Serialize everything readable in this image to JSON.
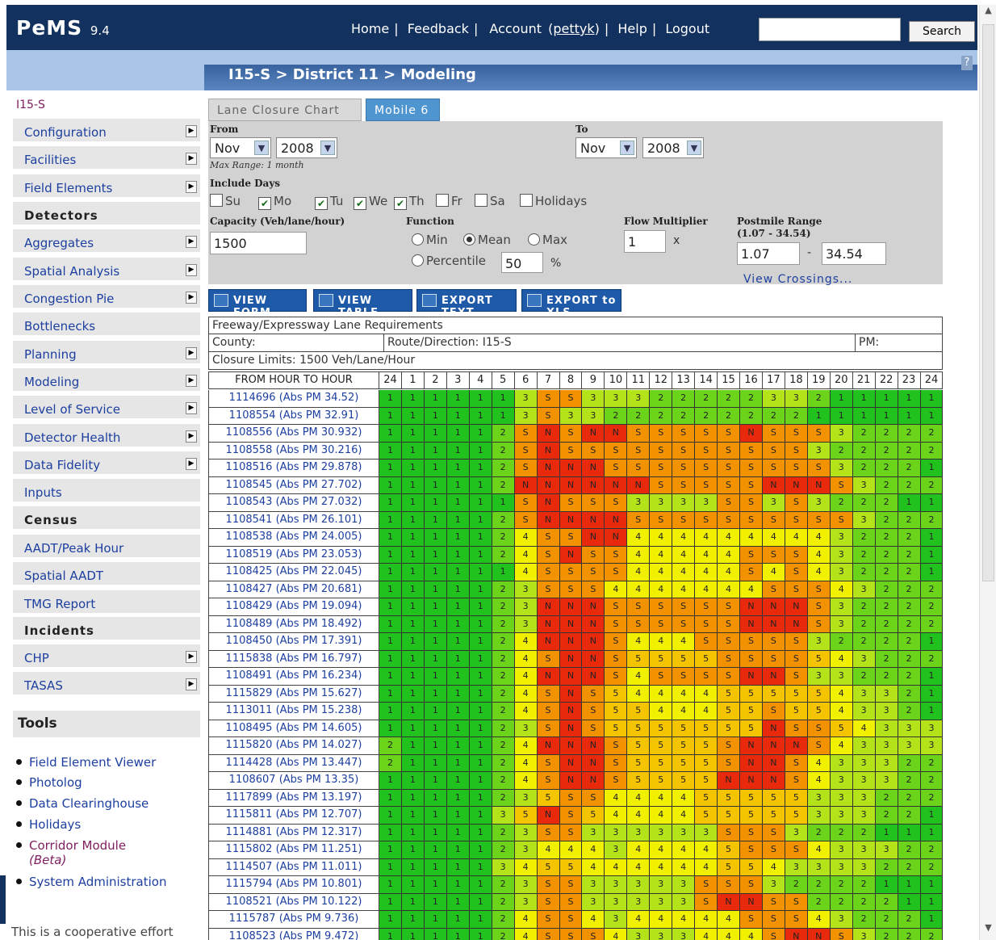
{
  "app": {
    "name": "PeMS",
    "version": "9.4"
  },
  "topnav": {
    "home": "Home",
    "feedback": "Feedback",
    "account": "Account",
    "account_user": "pettyk",
    "help": "Help",
    "logout": "Logout",
    "search_label": "Search",
    "search_value": ""
  },
  "breadcrumb": "I15-S > District 11 > Modeling",
  "help_icon": "?",
  "sidebar": {
    "title": "I15-S",
    "items": [
      {
        "label": "Configuration",
        "arrow": true
      },
      {
        "label": "Facilities",
        "arrow": true
      },
      {
        "label": "Field Elements",
        "arrow": true
      },
      {
        "label": "Detectors",
        "header": true
      },
      {
        "label": "Aggregates",
        "arrow": true
      },
      {
        "label": "Spatial Analysis",
        "arrow": true
      },
      {
        "label": "Congestion Pie",
        "arrow": true
      },
      {
        "label": "Bottlenecks",
        "arrow": false
      },
      {
        "label": "Planning",
        "arrow": true
      },
      {
        "label": "Modeling",
        "arrow": true
      },
      {
        "label": "Level of Service",
        "arrow": true
      },
      {
        "label": "Detector Health",
        "arrow": true
      },
      {
        "label": "Data Fidelity",
        "arrow": true
      },
      {
        "label": "Inputs",
        "arrow": false
      },
      {
        "label": "Census",
        "header": true
      },
      {
        "label": "AADT/Peak Hour",
        "arrow": false
      },
      {
        "label": "Spatial AADT",
        "arrow": false
      },
      {
        "label": "TMG Report",
        "arrow": false
      },
      {
        "label": "Incidents",
        "header": true
      },
      {
        "label": "CHP",
        "arrow": true
      },
      {
        "label": "TASAS",
        "arrow": true
      }
    ],
    "tools_title": "Tools",
    "tools": [
      "Field Element Viewer",
      "Photolog",
      "Data Clearinghouse",
      "Holidays",
      "Corridor Module",
      "System Administration"
    ],
    "tools_beta": "(Beta)",
    "coop_text": "This is a cooperative effort"
  },
  "tabs": [
    "Lane Closure Chart",
    "Mobile 6"
  ],
  "form": {
    "from_label": "From",
    "to_label": "To",
    "from_month": "Nov",
    "from_year": "2008",
    "to_month": "Nov",
    "to_year": "2008",
    "max_range": "Max Range: 1 month",
    "include_days_label": "Include Days",
    "days": [
      {
        "label": "Su",
        "checked": false
      },
      {
        "label": "Mo",
        "checked": true
      },
      {
        "label": "Tu",
        "checked": true
      },
      {
        "label": "We",
        "checked": true
      },
      {
        "label": "Th",
        "checked": true
      },
      {
        "label": "Fr",
        "checked": false
      },
      {
        "label": "Sa",
        "checked": false
      },
      {
        "label": "Holidays",
        "checked": false
      }
    ],
    "capacity_label": "Capacity (Veh/lane/hour)",
    "capacity_value": "1500",
    "function_label": "Function",
    "fn_min": "Min",
    "fn_mean": "Mean",
    "fn_max": "Max",
    "fn_percentile": "Percentile",
    "percentile_value": "50",
    "percent_sign": "%",
    "flow_label": "Flow Multiplier",
    "flow_value": "1",
    "flow_x": "x",
    "postmile_label": "Postmile Range",
    "postmile_range": "(1.07 - 34.54)",
    "postmile_from": "1.07",
    "dash": "-",
    "postmile_to": "34.54",
    "view_crossings": "View Crossings..."
  },
  "actions": [
    "VIEW FORM",
    "VIEW TABLE",
    "EXPORT TEXT",
    "EXPORT to XLS"
  ],
  "report": {
    "title": "Freeway/Expressway Lane Requirements",
    "county": "County:",
    "route": "Route/Direction: I15-S",
    "pm": "PM:",
    "closure": "Closure Limits: 1500 Veh/Lane/Hour",
    "hour_header": "FROM HOUR TO HOUR",
    "hours": [
      "24",
      "1",
      "2",
      "3",
      "4",
      "5",
      "6",
      "7",
      "8",
      "9",
      "10",
      "11",
      "12",
      "13",
      "14",
      "15",
      "16",
      "17",
      "18",
      "19",
      "20",
      "21",
      "22",
      "23",
      "24"
    ],
    "colors": {
      "1": "#22c21e",
      "2": "#6bd41a",
      "3": "#b5e31a",
      "4": "#f0f000",
      "5": "#f5c400",
      "S": "#f39200",
      "N": "#e8290c"
    },
    "rows": [
      {
        "label": "1114696 (Abs PM 34.52)",
        "v": "1111113SS33322222332111111"
      },
      {
        "label": "1108554 (Abs PM 32.91)",
        "v": "1111113S3322222222211111"
      },
      {
        "label": "1108556 (Abs PM 30.932)",
        "v": "111112SNSNNSSSSSNSSS3222211"
      },
      {
        "label": "1108558 (Abs PM 30.216)",
        "v": "111112SNSSSSSSSSSSS32222211"
      },
      {
        "label": "1108516 (Abs PM 29.878)",
        "v": "111112SNNNSSSSSSSSSS3222111"
      },
      {
        "label": "1108545 (Abs PM 27.702)",
        "v": "111112NNNNNNSSSSSNNNS3222211"
      },
      {
        "label": "1108543 (Abs PM 27.032)",
        "v": "111111SNSSS3333SS3S322211"
      },
      {
        "label": "1108541 (Abs PM 26.101)",
        "v": "111112SNNNNSSSSSSSSSS3222211"
      },
      {
        "label": "1108538 (Abs PM 24.005)",
        "v": "1111124SSNN4444444443222111"
      },
      {
        "label": "1108519 (Abs PM 23.053)",
        "v": "1111124SNSS44444SSS4322211"
      },
      {
        "label": "1108425 (Abs PM 22.045)",
        "v": "1111114SSSS44444S4S4322211"
      },
      {
        "label": "1108427 (Abs PM 20.681)",
        "v": "1111123SSS4444444SSS4322222"
      },
      {
        "label": "1108429 (Abs PM 19.094)",
        "v": "1111123NNNSSSSSSNNNS3222211"
      },
      {
        "label": "1108489 (Abs PM 18.492)",
        "v": "1111123NNNSSSSSSNNNS3222211"
      },
      {
        "label": "1108450 (Abs PM 17.391)",
        "v": "1111124NNNS444SSSSS3222211"
      },
      {
        "label": "1115838 (Abs PM 16.797)",
        "v": "1111124SNNS5555SSSS5432222"
      },
      {
        "label": "1108491 (Abs PM 16.234)",
        "v": "1111124NNNS4SSSSNNS3322211"
      },
      {
        "label": "1115829 (Abs PM 15.627)",
        "v": "1111124SNS5444455555433211"
      },
      {
        "label": "1113011 (Abs PM 15.238)",
        "v": "1111124SNS5544455S55433211"
      },
      {
        "label": "1108495 (Abs PM 14.605)",
        "v": "1111123SNS5555555NSS5433322"
      },
      {
        "label": "1115820 (Abs PM 14.027)",
        "v": "2111124NNNS5555SNNNS4333322"
      },
      {
        "label": "1114428 (Abs PM 13.447)",
        "v": "2111124SNNS5555SNNS4333222"
      },
      {
        "label": "1108607 (Abs PM 13.35)",
        "v": "1111124SNNS5555NNNS4333222"
      },
      {
        "label": "1117899 (Abs PM 13.197)",
        "v": "11111235SS444455555333222"
      },
      {
        "label": "1115811 (Abs PM 12.707)",
        "v": "1111135NS5444455555333221"
      },
      {
        "label": "1114881 (Abs PM 12.317)",
        "v": "1111123SS333333SSS3222111"
      },
      {
        "label": "1115802 (Abs PM 11.251)",
        "v": "1111123444344445SSS4333222"
      },
      {
        "label": "1114507 (Abs PM 11.011)",
        "v": "1111134554444445543333222"
      },
      {
        "label": "1115794 (Abs PM 10.801)",
        "v": "1111123SS33333SSS3222211"
      },
      {
        "label": "1108521 (Abs PM 10.122)",
        "v": "1111123SS33333SNNSS222211"
      },
      {
        "label": "1115787 (Abs PM 9.736)",
        "v": "1111124SS4344444SSS4322211"
      },
      {
        "label": "1108523 (Abs PM 9.472)",
        "v": "1111124SSS4333444SNNS322222"
      }
    ]
  }
}
